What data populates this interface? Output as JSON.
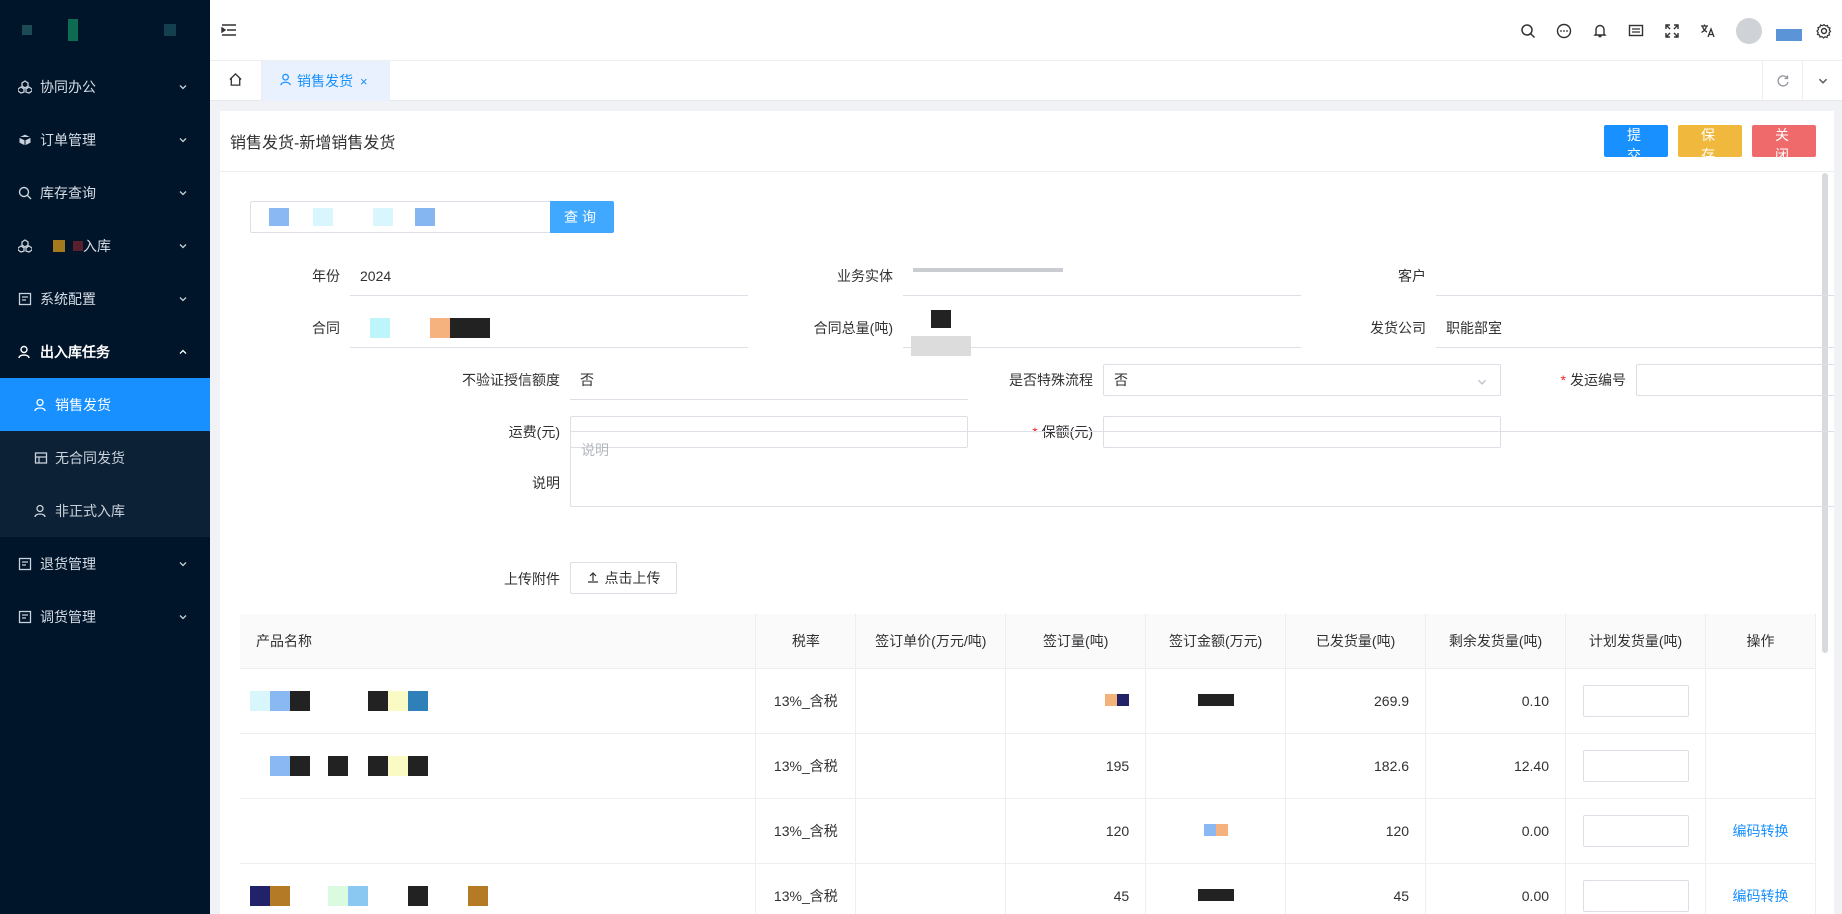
{
  "sidebar": {
    "items": [
      {
        "label": "协同办公",
        "icon": "cubes-icon"
      },
      {
        "label": "订单管理",
        "icon": "box-icon"
      },
      {
        "label": "库存查询",
        "icon": "search-icon"
      },
      {
        "label": "入库",
        "icon": "cubes-icon"
      },
      {
        "label": "系统配置",
        "icon": "form-icon"
      },
      {
        "label": "出入库任务",
        "icon": "user-icon"
      }
    ],
    "subitems": [
      {
        "label": "销售发货"
      },
      {
        "label": "无合同发货"
      },
      {
        "label": "非正式入库"
      }
    ],
    "items_after": [
      {
        "label": "退货管理"
      },
      {
        "label": "调货管理"
      }
    ]
  },
  "tabs": {
    "active_label": "销售发货",
    "close": "×"
  },
  "panel": {
    "title": "销售发货-新增销售发货",
    "submit": "提交",
    "save": "保存",
    "close": "关闭",
    "query": "查询"
  },
  "form": {
    "year_label": "年份",
    "year_value": "2024",
    "entity_label": "业务实体",
    "customer_label": "客户",
    "contract_label": "合同",
    "total_label": "合同总量(吨)",
    "ship_company_label": "发货公司",
    "ship_company_value": "职能部室",
    "no_verify_label": "不验证授信额度",
    "no_verify_value": "否",
    "special_label": "是否特殊流程",
    "special_value": "否",
    "ship_no_label": "发运编号",
    "freight_label": "运费(元)",
    "insurance_label": "保额(元)",
    "desc_label": "说明",
    "desc_placeholder": "说明",
    "upload_label": "上传附件",
    "upload_button": "点击上传"
  },
  "table": {
    "headers": [
      "产品名称",
      "税率",
      "签订单价(万元/吨)",
      "签订量(吨)",
      "签订金额(万元)",
      "已发货量(吨)",
      "剩余发货量(吨)",
      "计划发货量(吨)",
      "操作"
    ],
    "rows": [
      {
        "tax": "13%_含税",
        "qty": "",
        "shipped": "269.9",
        "remaining": "0.10",
        "action": ""
      },
      {
        "tax": "13%_含税",
        "qty": "195",
        "shipped": "182.6",
        "remaining": "12.40",
        "action": ""
      },
      {
        "tax": "13%_含税",
        "qty": "120",
        "shipped": "120",
        "remaining": "0.00",
        "action": "编码转换"
      },
      {
        "tax": "13%_含税",
        "qty": "45",
        "shipped": "45",
        "remaining": "0.00",
        "action": "编码转换"
      }
    ]
  },
  "colors": {
    "sidebar_bg": "#001529",
    "accent": "#1890ff",
    "save": "#f0b93d",
    "close": "#ef6b6b"
  }
}
